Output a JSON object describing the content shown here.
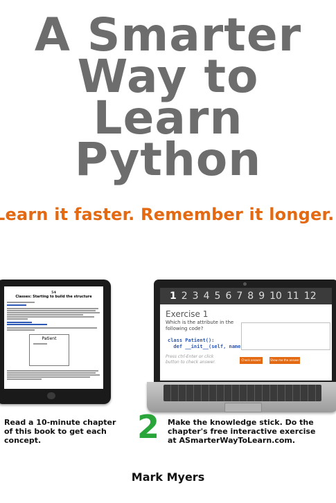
{
  "cover": {
    "title_lines": [
      "A Smarter",
      "Way to",
      "Learn",
      "Python"
    ],
    "tagline": "Learn it faster. Remember it longer.",
    "author": "Mark Myers",
    "colors": {
      "title": "#6d6d6d",
      "tagline": "#e36a12",
      "step_number": "#2aa53a"
    }
  },
  "tablet": {
    "chapter_number": "54",
    "chapter_title": "Classes: Starting to build the structure",
    "diagram_label": "Patient"
  },
  "laptop": {
    "numbers": [
      "1",
      "2",
      "3",
      "4",
      "5",
      "6",
      "7",
      "8",
      "9",
      "10",
      "11",
      "12"
    ],
    "exercise_title": "Exercise 1",
    "question": "Which is the attribute in the following code?",
    "code_line_1": "class Patient():",
    "code_line_2": "  def __init__(self, name)",
    "hint": "Press ctrl-Enter or click button to check answer.",
    "check_button": "Check answer",
    "show_button": "Show me the answer"
  },
  "captions": {
    "left": "Read a 10-minute chapter of this book to get each concept.",
    "step_number": "2",
    "right_line_1": "Make the knowledge stick. Do the",
    "right_line_2": "chapter's free interactive exercise",
    "right_line_3": "at ASmarterWayToLearn.com."
  }
}
